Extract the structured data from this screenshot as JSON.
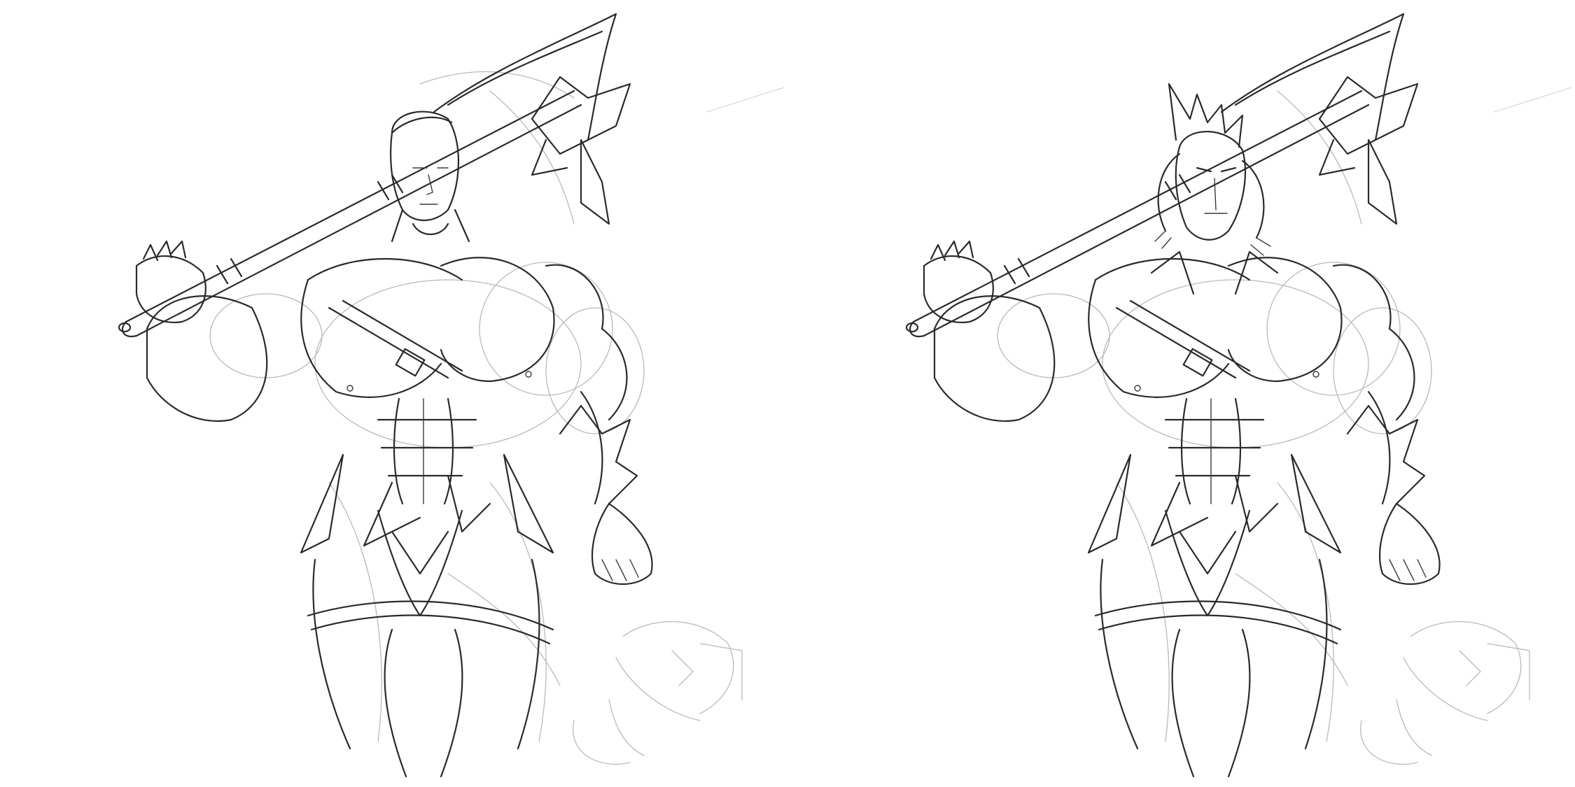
{
  "panels": [
    {
      "id": "before",
      "head": "human-head"
    },
    {
      "id": "after",
      "head": "beast-head"
    }
  ],
  "colors": {
    "background": "#ffffff",
    "ink": "#2a2a2a",
    "sketch": "#b9b9b9"
  }
}
